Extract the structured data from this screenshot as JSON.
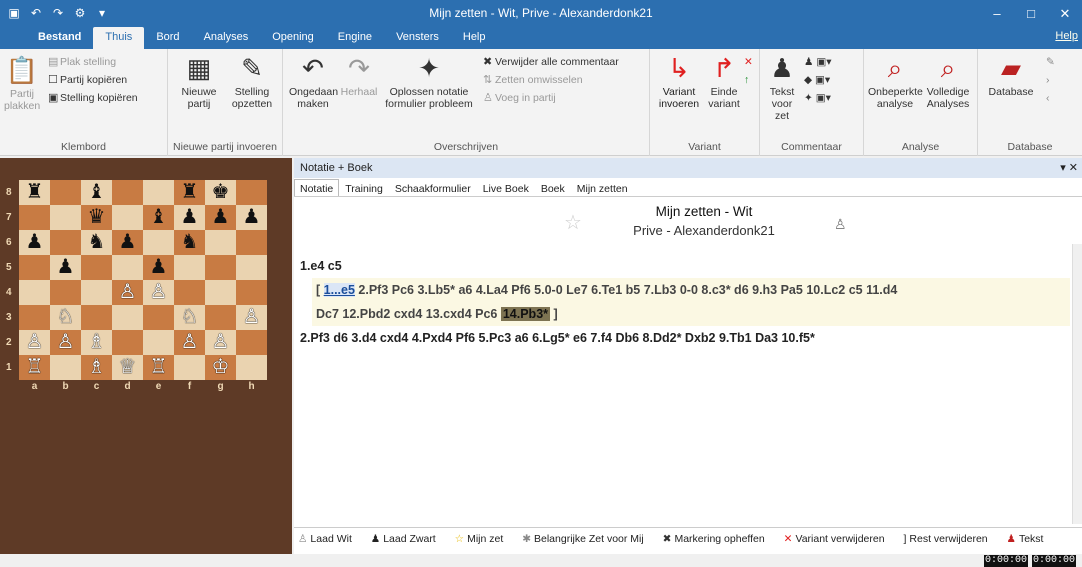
{
  "window": {
    "title": "Mijn zetten - Wit, Prive - Alexanderdonk21"
  },
  "menu": {
    "tabs": [
      "Bestand",
      "Thuis",
      "Bord",
      "Analyses",
      "Opening",
      "Engine",
      "Vensters",
      "Help"
    ],
    "active": "Thuis",
    "help_link": "Help"
  },
  "ribbon": {
    "klembord": {
      "label": "Klembord",
      "partij_plakken": "Partij plakken",
      "plak_stelling": "Plak stelling",
      "partij_kopieren": "Partij kopiëren",
      "stelling_kopieren": "Stelling kopiëren"
    },
    "nieuwe_partij": {
      "label": "Nieuwe partij invoeren",
      "nieuwe_partij": "Nieuwe partij",
      "stelling_opzetten": "Stelling opzetten"
    },
    "overschrijven": {
      "label": "Overschrijven",
      "ongedaan": "Ongedaan maken",
      "herhaal": "Herhaal",
      "oplossen": "Oplossen notatie formulier probleem",
      "verwijder_commentaar": "Verwijder alle commentaar",
      "zetten_omwisselen": "Zetten omwisselen",
      "voeg_in": "Voeg in partij"
    },
    "variant": {
      "label": "Variant",
      "invoeren": "Variant invoeren",
      "einde": "Einde variant"
    },
    "commentaar": {
      "label": "Commentaar",
      "tekst": "Tekst voor zet"
    },
    "analyse": {
      "label": "Analyse",
      "onbeperkte": "Onbeperkte analyse",
      "volledige": "Volledige Analyses"
    },
    "database": {
      "label": "Database",
      "database": "Database"
    }
  },
  "board": {
    "ranks": [
      "8",
      "7",
      "6",
      "5",
      "4",
      "3",
      "2",
      "1"
    ],
    "files": [
      "a",
      "b",
      "c",
      "d",
      "e",
      "f",
      "g",
      "h"
    ],
    "position": [
      [
        "♜",
        "",
        "♝",
        "",
        "",
        "♜",
        "♚",
        ""
      ],
      [
        "",
        "",
        "♛",
        "",
        "♝",
        "♟",
        "♟",
        "♟"
      ],
      [
        "♟",
        "",
        "♞",
        "♟",
        "",
        "♞",
        "",
        ""
      ],
      [
        "",
        "♟",
        "",
        "",
        "♟",
        "",
        "",
        ""
      ],
      [
        "",
        "",
        "",
        "♙",
        "♙",
        "",
        "",
        ""
      ],
      [
        "",
        "♘",
        "",
        "",
        "",
        "♘",
        "",
        "♙"
      ],
      [
        "♙",
        "♙",
        "♗",
        "",
        "",
        "♙",
        "♙",
        ""
      ],
      [
        "♖",
        "",
        "♗",
        "♕",
        "♖",
        "",
        "♔",
        ""
      ]
    ]
  },
  "notation": {
    "pane_title": "Notatie + Boek",
    "tabs": [
      "Notatie",
      "Training",
      "Schaakformulier",
      "Live Boek",
      "Boek",
      "Mijn zetten"
    ],
    "active_tab": "Notatie",
    "game_title": "Mijn zetten - Wit",
    "game_subtitle": "Prive - Alexanderdonk21",
    "line1": "1.e4 c5",
    "var_open": "[ ",
    "var_first": "1...e5",
    "var_rest_a": " 2.Pf3 Pc6 3.Lb5* a6 4.La4 Pf6 5.0-0 Le7 6.Te1 b5 7.Lb3 0-0 8.c3* d6 9.h3 Pa5 10.Lc2 c5 11.d4",
    "var_rest_b": "Dc7 12.Pbd2 cxd4 13.cxd4 Pc6 ",
    "var_current": "14.Pb3*",
    "var_close": " ]",
    "line3": "2.Pf3 d6 3.d4 cxd4 4.Pxd4 Pf6 5.Pc3 a6 6.Lg5* e6 7.f4 Db6 8.Dd2* Dxb2 9.Tb1 Da3 10.f5*"
  },
  "bottombar": [
    "Laad Wit",
    "Laad Zwart",
    "Mijn zet",
    "Belangrijke Zet voor Mij",
    "Markering opheffen",
    "Variant verwijderen",
    "Rest verwijderen",
    "Tekst"
  ],
  "clocks": [
    "0:00:00",
    "0:00:00"
  ]
}
